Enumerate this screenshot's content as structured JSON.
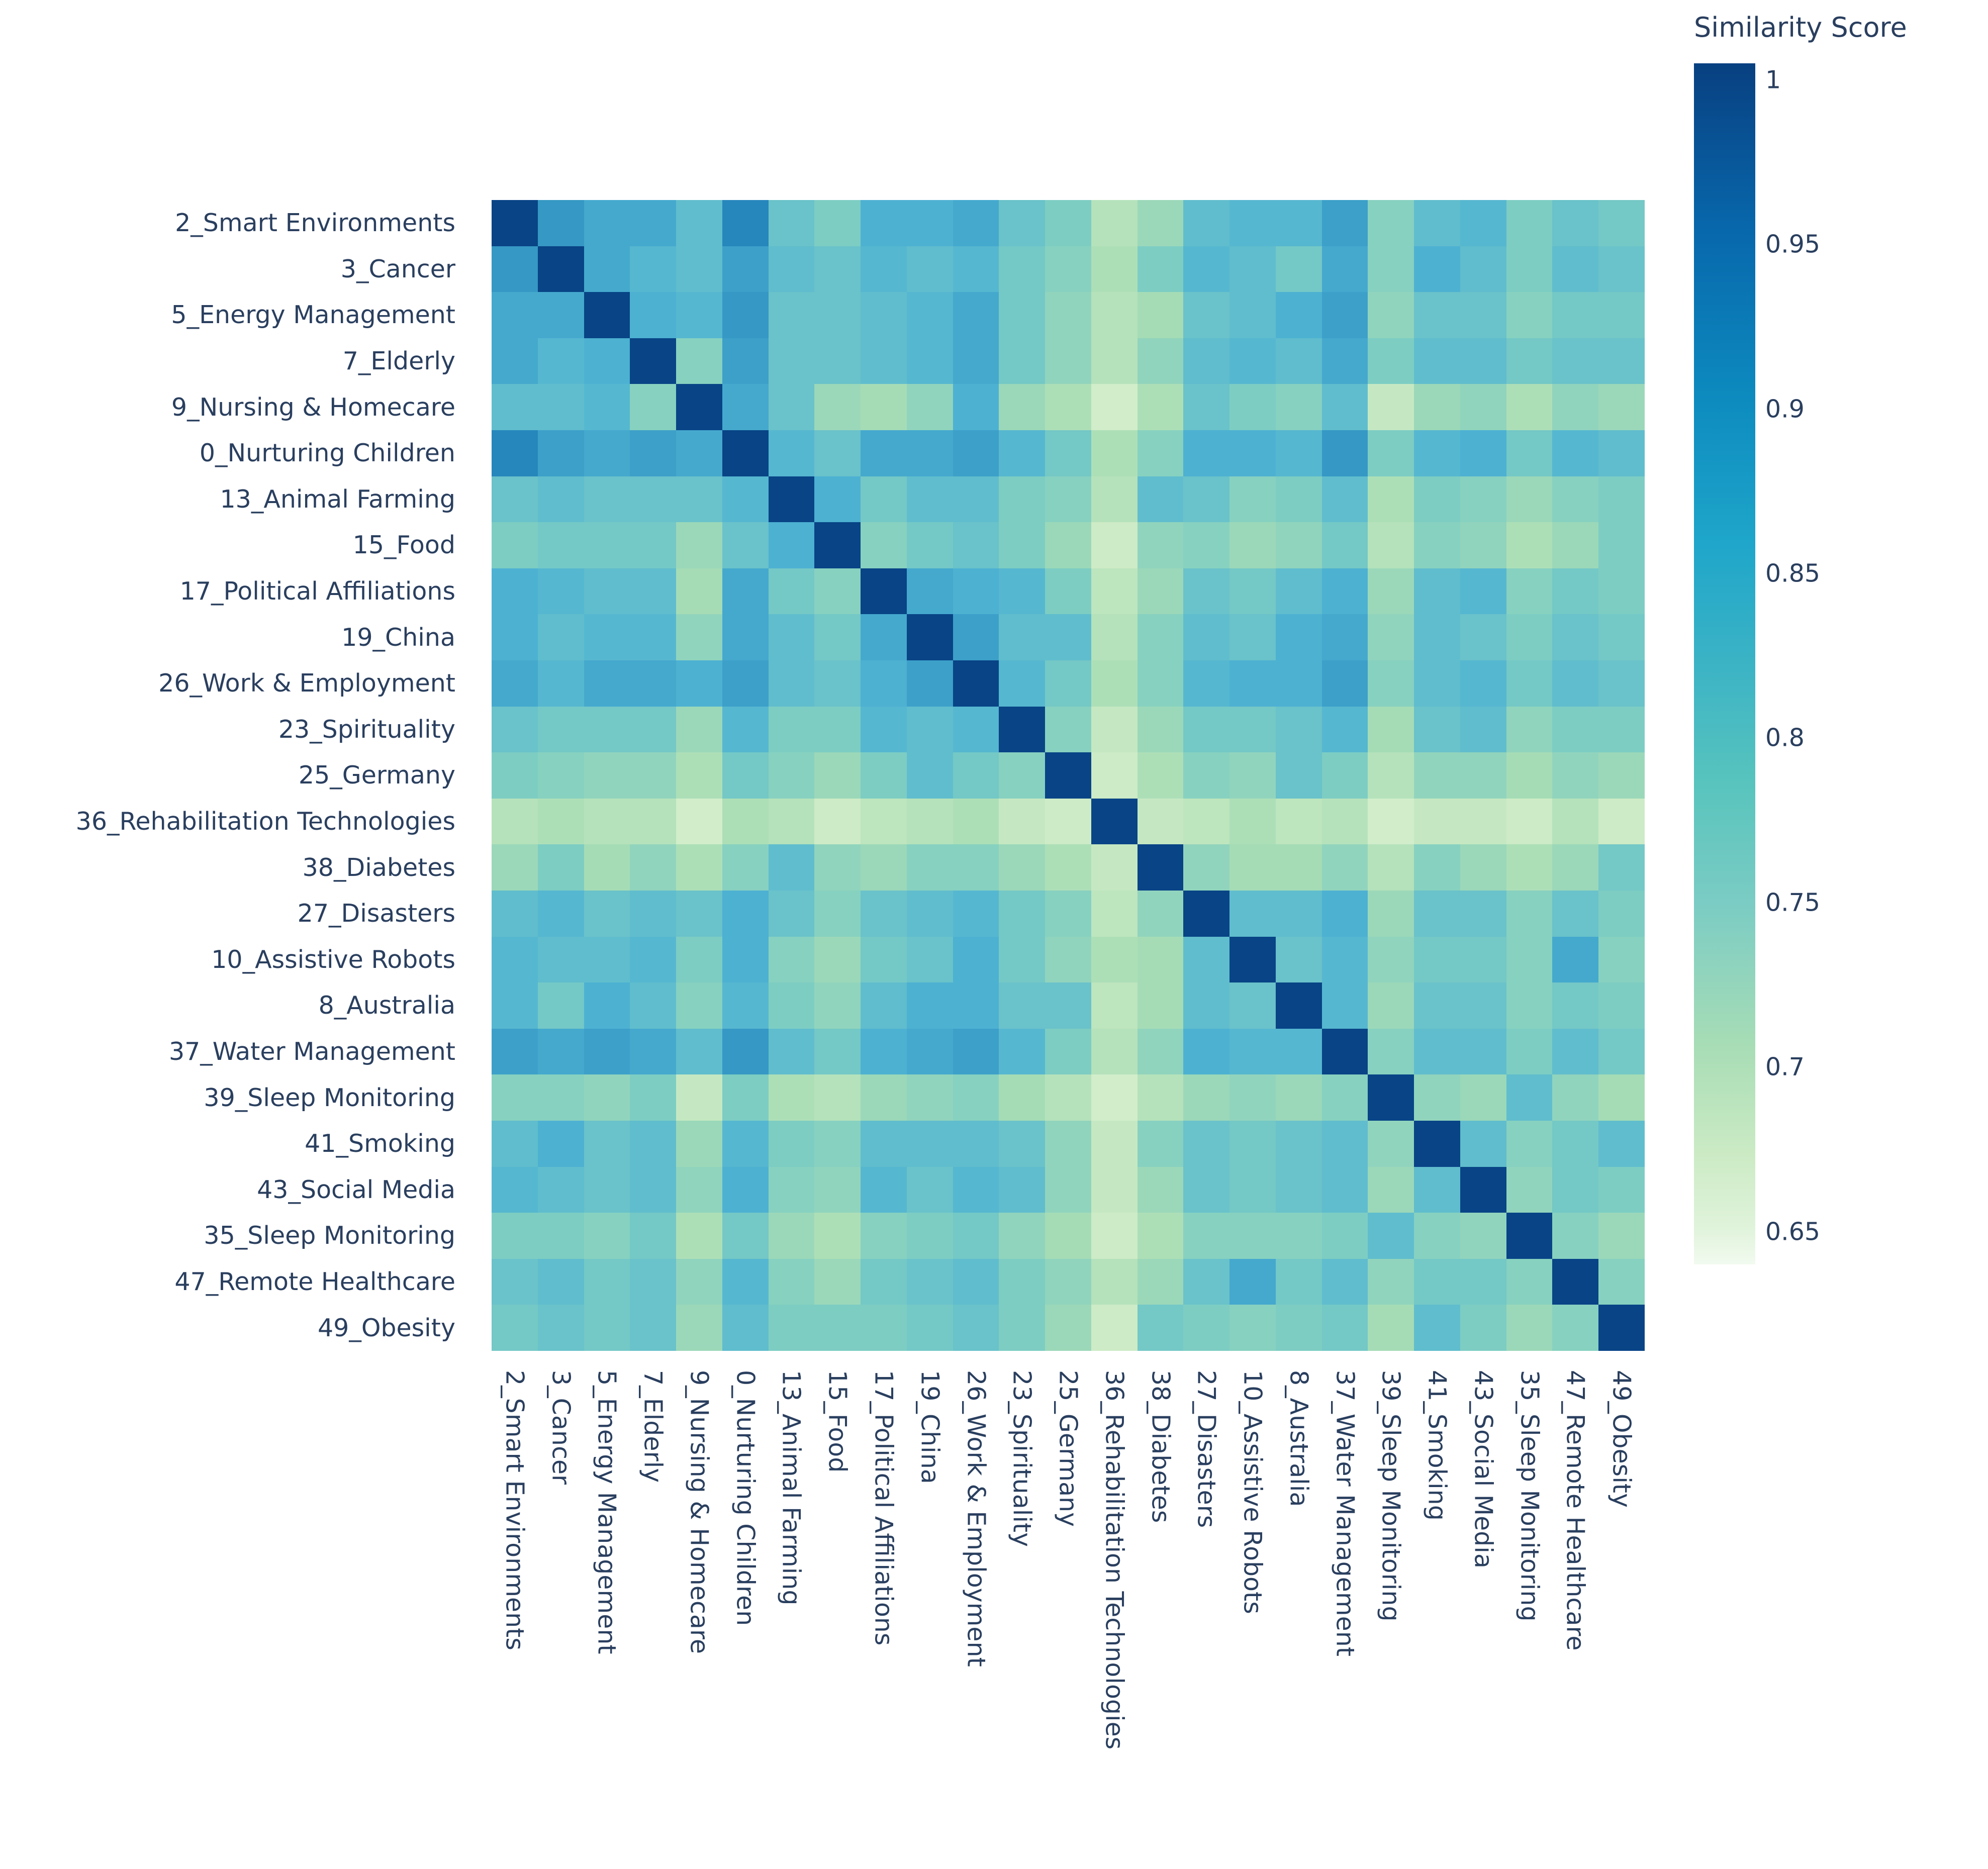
{
  "colorbar": {
    "title": "Similarity Score",
    "ticks": [
      "1",
      "0.95",
      "0.9",
      "0.85",
      "0.8",
      "0.75",
      "0.7",
      "0.65"
    ],
    "tick_values": [
      1,
      0.95,
      0.9,
      0.85,
      0.8,
      0.75,
      0.7,
      0.65
    ],
    "colorscale_name": "GnBu",
    "vmin": 0.64,
    "vmax": 1.005
  },
  "axis_label_color": "#2a3f5f",
  "chart_data": {
    "type": "heatmap",
    "title": "",
    "xlabel": "",
    "ylabel": "",
    "colorbar_label": "Similarity Score",
    "zmin": 0.64,
    "zmax": 1.005,
    "colorscale": [
      "#084081",
      "#0868ac",
      "#2b8cbe",
      "#4eb3d3",
      "#7bccc4",
      "#a8ddb5",
      "#ccebc5",
      "#e0f3db",
      "#f7fcf0"
    ],
    "grid": false,
    "categories": [
      "2_Smart Environments",
      "3_Cancer",
      "5_Energy Management",
      "7_Elderly",
      "9_Nursing & Homecare",
      "0_Nurturing Children",
      "13_Animal Farming",
      "15_Food",
      "17_Political Affiliations",
      "19_China",
      "26_Work & Employment",
      "23_Spirituality",
      "25_Germany",
      "36_Rehabilitation Technologies",
      "38_Diabetes",
      "27_Disasters",
      "10_Assistive Robots",
      "8_Australia",
      "37_Water Management",
      "39_Sleep Monitoring",
      "41_Smoking",
      "43_Social Media",
      "35_Sleep Monitoring",
      "47_Remote Healthcare",
      "49_Obesity"
    ],
    "x": [
      "2_Smart Environments",
      "3_Cancer",
      "5_Energy Management",
      "7_Elderly",
      "9_Nursing & Homecare",
      "0_Nurturing Children",
      "13_Animal Farming",
      "15_Food",
      "17_Political Affiliations",
      "19_China",
      "26_Work & Employment",
      "23_Spirituality",
      "25_Germany",
      "36_Rehabilitation Technologies",
      "38_Diabetes",
      "27_Disasters",
      "10_Assistive Robots",
      "8_Australia",
      "37_Water Management",
      "39_Sleep Monitoring",
      "41_Smoking",
      "43_Social Media",
      "35_Sleep Monitoring",
      "47_Remote Healthcare",
      "49_Obesity"
    ],
    "y": [
      "2_Smart Environments",
      "3_Cancer",
      "5_Energy Management",
      "7_Elderly",
      "9_Nursing & Homecare",
      "0_Nurturing Children",
      "13_Animal Farming",
      "15_Food",
      "17_Political Affiliations",
      "19_China",
      "26_Work & Employment",
      "23_Spirituality",
      "25_Germany",
      "36_Rehabilitation Technologies",
      "38_Diabetes",
      "27_Disasters",
      "10_Assistive Robots",
      "8_Australia",
      "37_Water Management",
      "39_Sleep Monitoring",
      "41_Smoking",
      "43_Social Media",
      "35_Sleep Monitoring",
      "47_Remote Healthcare",
      "49_Obesity"
    ],
    "z": [
      [
        1.0,
        0.9,
        0.88,
        0.88,
        0.85,
        0.92,
        0.84,
        0.82,
        0.87,
        0.87,
        0.88,
        0.84,
        0.82,
        0.76,
        0.79,
        0.85,
        0.86,
        0.86,
        0.89,
        0.81,
        0.85,
        0.86,
        0.82,
        0.84,
        0.83
      ],
      [
        0.9,
        1.0,
        0.88,
        0.86,
        0.85,
        0.89,
        0.85,
        0.84,
        0.86,
        0.85,
        0.86,
        0.83,
        0.81,
        0.77,
        0.82,
        0.86,
        0.85,
        0.83,
        0.88,
        0.81,
        0.87,
        0.85,
        0.82,
        0.85,
        0.84
      ],
      [
        0.88,
        0.88,
        1.0,
        0.87,
        0.86,
        0.9,
        0.84,
        0.84,
        0.85,
        0.86,
        0.88,
        0.83,
        0.8,
        0.76,
        0.78,
        0.84,
        0.85,
        0.87,
        0.89,
        0.8,
        0.84,
        0.84,
        0.81,
        0.83,
        0.83
      ],
      [
        0.88,
        0.86,
        0.87,
        1.0,
        0.81,
        0.89,
        0.84,
        0.84,
        0.85,
        0.86,
        0.88,
        0.83,
        0.8,
        0.76,
        0.8,
        0.85,
        0.86,
        0.85,
        0.88,
        0.82,
        0.85,
        0.85,
        0.83,
        0.84,
        0.84
      ],
      [
        0.85,
        0.85,
        0.86,
        0.81,
        1.0,
        0.88,
        0.84,
        0.79,
        0.78,
        0.8,
        0.87,
        0.79,
        0.77,
        0.72,
        0.77,
        0.84,
        0.82,
        0.81,
        0.85,
        0.74,
        0.79,
        0.8,
        0.77,
        0.8,
        0.79
      ],
      [
        0.92,
        0.89,
        0.88,
        0.89,
        0.88,
        1.0,
        0.86,
        0.84,
        0.88,
        0.88,
        0.89,
        0.86,
        0.83,
        0.77,
        0.81,
        0.87,
        0.87,
        0.86,
        0.9,
        0.82,
        0.86,
        0.87,
        0.83,
        0.86,
        0.85
      ],
      [
        0.84,
        0.85,
        0.84,
        0.84,
        0.84,
        0.86,
        1.0,
        0.87,
        0.83,
        0.85,
        0.85,
        0.82,
        0.81,
        0.76,
        0.85,
        0.84,
        0.81,
        0.82,
        0.85,
        0.77,
        0.82,
        0.81,
        0.79,
        0.81,
        0.82
      ],
      [
        0.82,
        0.83,
        0.83,
        0.83,
        0.79,
        0.84,
        0.87,
        1.0,
        0.81,
        0.83,
        0.84,
        0.82,
        0.79,
        0.73,
        0.8,
        0.81,
        0.79,
        0.8,
        0.83,
        0.76,
        0.81,
        0.8,
        0.77,
        0.79,
        0.82
      ],
      [
        0.87,
        0.86,
        0.85,
        0.85,
        0.78,
        0.88,
        0.83,
        0.81,
        1.0,
        0.88,
        0.87,
        0.86,
        0.82,
        0.75,
        0.79,
        0.84,
        0.83,
        0.85,
        0.87,
        0.79,
        0.85,
        0.86,
        0.81,
        0.83,
        0.82
      ],
      [
        0.87,
        0.85,
        0.86,
        0.86,
        0.8,
        0.88,
        0.85,
        0.83,
        0.88,
        1.0,
        0.89,
        0.85,
        0.85,
        0.76,
        0.81,
        0.85,
        0.84,
        0.87,
        0.88,
        0.8,
        0.85,
        0.84,
        0.82,
        0.84,
        0.83
      ],
      [
        0.88,
        0.86,
        0.88,
        0.88,
        0.87,
        0.89,
        0.85,
        0.84,
        0.87,
        0.89,
        1.0,
        0.86,
        0.83,
        0.77,
        0.81,
        0.86,
        0.87,
        0.87,
        0.89,
        0.81,
        0.85,
        0.86,
        0.83,
        0.85,
        0.84
      ],
      [
        0.84,
        0.83,
        0.83,
        0.83,
        0.79,
        0.86,
        0.82,
        0.82,
        0.86,
        0.85,
        0.86,
        1.0,
        0.81,
        0.74,
        0.79,
        0.83,
        0.83,
        0.84,
        0.86,
        0.78,
        0.84,
        0.85,
        0.8,
        0.82,
        0.82
      ],
      [
        0.82,
        0.81,
        0.8,
        0.8,
        0.77,
        0.83,
        0.81,
        0.79,
        0.82,
        0.85,
        0.83,
        0.81,
        1.0,
        0.73,
        0.77,
        0.81,
        0.8,
        0.84,
        0.82,
        0.76,
        0.8,
        0.8,
        0.78,
        0.8,
        0.79
      ],
      [
        0.76,
        0.77,
        0.76,
        0.76,
        0.72,
        0.77,
        0.76,
        0.73,
        0.75,
        0.76,
        0.77,
        0.74,
        0.73,
        1.0,
        0.74,
        0.75,
        0.77,
        0.75,
        0.76,
        0.72,
        0.74,
        0.74,
        0.73,
        0.76,
        0.73
      ],
      [
        0.79,
        0.82,
        0.78,
        0.8,
        0.77,
        0.81,
        0.85,
        0.8,
        0.79,
        0.81,
        0.81,
        0.79,
        0.77,
        0.74,
        1.0,
        0.8,
        0.78,
        0.78,
        0.8,
        0.76,
        0.81,
        0.79,
        0.77,
        0.79,
        0.83
      ],
      [
        0.85,
        0.86,
        0.84,
        0.85,
        0.84,
        0.87,
        0.84,
        0.81,
        0.84,
        0.85,
        0.86,
        0.83,
        0.81,
        0.75,
        0.8,
        1.0,
        0.85,
        0.85,
        0.87,
        0.79,
        0.84,
        0.84,
        0.81,
        0.84,
        0.82
      ],
      [
        0.86,
        0.85,
        0.85,
        0.86,
        0.82,
        0.87,
        0.81,
        0.79,
        0.83,
        0.84,
        0.87,
        0.83,
        0.8,
        0.77,
        0.78,
        0.85,
        1.0,
        0.84,
        0.86,
        0.8,
        0.83,
        0.83,
        0.81,
        0.88,
        0.81
      ],
      [
        0.86,
        0.83,
        0.87,
        0.85,
        0.81,
        0.86,
        0.82,
        0.8,
        0.85,
        0.87,
        0.87,
        0.84,
        0.84,
        0.75,
        0.78,
        0.85,
        0.84,
        1.0,
        0.86,
        0.79,
        0.84,
        0.84,
        0.81,
        0.83,
        0.82
      ],
      [
        0.89,
        0.88,
        0.89,
        0.88,
        0.85,
        0.9,
        0.85,
        0.83,
        0.87,
        0.88,
        0.89,
        0.86,
        0.82,
        0.76,
        0.8,
        0.87,
        0.86,
        0.86,
        1.0,
        0.81,
        0.85,
        0.85,
        0.82,
        0.85,
        0.83
      ],
      [
        0.81,
        0.81,
        0.8,
        0.82,
        0.74,
        0.82,
        0.77,
        0.76,
        0.79,
        0.8,
        0.81,
        0.78,
        0.76,
        0.72,
        0.76,
        0.79,
        0.8,
        0.79,
        0.81,
        1.0,
        0.8,
        0.79,
        0.85,
        0.8,
        0.78
      ],
      [
        0.85,
        0.87,
        0.84,
        0.85,
        0.79,
        0.86,
        0.82,
        0.81,
        0.85,
        0.85,
        0.85,
        0.84,
        0.8,
        0.74,
        0.81,
        0.84,
        0.83,
        0.84,
        0.85,
        0.8,
        1.0,
        0.85,
        0.81,
        0.83,
        0.85
      ],
      [
        0.86,
        0.85,
        0.84,
        0.85,
        0.8,
        0.87,
        0.81,
        0.8,
        0.86,
        0.84,
        0.86,
        0.85,
        0.8,
        0.74,
        0.79,
        0.84,
        0.83,
        0.84,
        0.85,
        0.79,
        0.85,
        1.0,
        0.8,
        0.83,
        0.82
      ],
      [
        0.82,
        0.82,
        0.81,
        0.83,
        0.77,
        0.83,
        0.79,
        0.77,
        0.81,
        0.82,
        0.83,
        0.8,
        0.78,
        0.73,
        0.77,
        0.81,
        0.81,
        0.81,
        0.82,
        0.85,
        0.81,
        0.8,
        1.0,
        0.81,
        0.79
      ],
      [
        0.84,
        0.85,
        0.83,
        0.84,
        0.8,
        0.86,
        0.81,
        0.79,
        0.83,
        0.84,
        0.85,
        0.82,
        0.8,
        0.76,
        0.79,
        0.84,
        0.88,
        0.83,
        0.85,
        0.8,
        0.83,
        0.83,
        0.81,
        1.0,
        0.81
      ],
      [
        0.83,
        0.84,
        0.83,
        0.84,
        0.79,
        0.85,
        0.82,
        0.82,
        0.82,
        0.83,
        0.84,
        0.82,
        0.79,
        0.73,
        0.83,
        0.82,
        0.81,
        0.82,
        0.83,
        0.78,
        0.85,
        0.82,
        0.79,
        0.81,
        1.0
      ]
    ]
  }
}
